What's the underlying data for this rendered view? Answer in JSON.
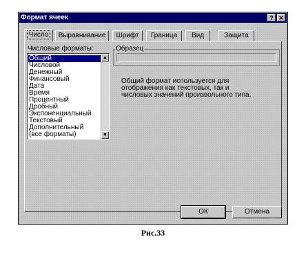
{
  "dialog": {
    "title": "Формат ячеек",
    "help_button": "?",
    "close_button": "✕"
  },
  "tabs": [
    {
      "label": "Число",
      "active": true
    },
    {
      "label": "Выравнивание",
      "active": false
    },
    {
      "label": "Шрифт",
      "active": false
    },
    {
      "label": "Граница",
      "active": false
    },
    {
      "label": "Вид",
      "active": false
    },
    {
      "label": "Защита",
      "active": false
    }
  ],
  "formats": {
    "label": "Числовые форматы:",
    "selected": "Общий",
    "items": [
      "Общий",
      "Числовой",
      "Денежный",
      "Финансовый",
      "Дата",
      "Время",
      "Процентный",
      "Дробный",
      "Экспоненциальный",
      "Текстовый",
      "Дополнительный",
      "(все форматы)"
    ]
  },
  "sample": {
    "label": "Образец",
    "value": ""
  },
  "description": {
    "line1": "Общий формат используется для",
    "line2": "отображения как текстовых, так и",
    "line3": "числовых значений произвольного типа."
  },
  "buttons": {
    "ok": "ОК",
    "cancel": "Отмена"
  },
  "caption": "Рис.33"
}
